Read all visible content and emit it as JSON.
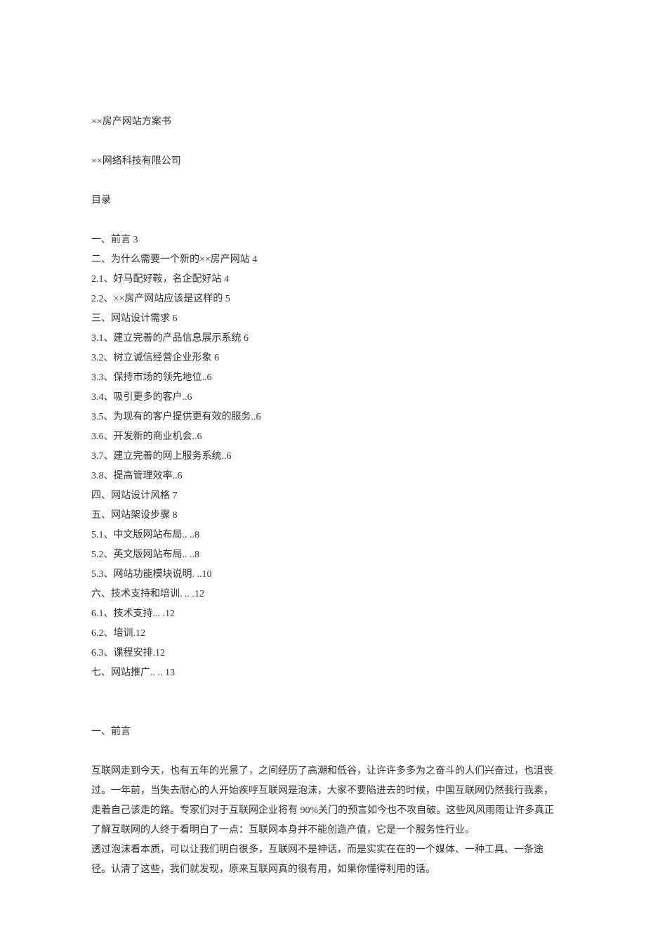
{
  "header": {
    "title": "××房产网站方案书",
    "company": "××网络科技有限公司"
  },
  "toc": {
    "heading": "目录",
    "items": [
      "一、前言 3",
      "二、为什么需要一个新的××房产网站 4",
      "2.1、好马配好鞍，名企配好站 4",
      "2.2、××房产网站应该是这样的 5",
      "三、网站设计需求 6",
      "3.1、建立完善的产品信息展示系统  6",
      "3.2、树立诚信经营企业形象 6",
      "3.3、保持市场的领先地位..6",
      "3.4、吸引更多的客户..6",
      "3.5、为现有的客户提供更有效的服务..6",
      "3.6、开发新的商业机会..6",
      "3.7、建立完善的网上服务系统..6",
      "3.8、提高管理效率..6",
      "四、网站设计风格 7",
      "五、网站架设步骤 8",
      "5.1、中文版网站布局.. ..8",
      "5.2、英文版网站布局.. ..8",
      "5.3、网站功能模块说明. ..10",
      "六、技术支持和培训. .. .12",
      "6.1、技术支持... .12",
      "6.2、培训.12",
      "6.3、课程安排.12",
      "七、网站推广.. .. 13"
    ]
  },
  "section1": {
    "heading": "一、前言",
    "paragraphs": [
      "互联网走到今天，也有五年的光景了，之间经历了高潮和低谷，让许许多多为之奋斗的人们兴奋过，也沮丧过。一年前，当失去耐心的人开始疾呼互联网是泡沫，大家不要陷进去的时候，中国互联网仍然我行我素，走着自己该走的路。专家们对于互联网企业将有 90%关门的预言如今也不攻自破。这些风风雨雨让许多真正了解互联网的人终于看明白了一点：互联网本身并不能创造产值，它是一个服务性行业。",
      "透过泡沫看本质，可以让我们明白很多，互联网不是神话，而是实实在在的一个媒体、一种工具、一条途径。认清了这些，我们就发现，原来互联网真的很有用，如果你懂得利用的话。"
    ]
  }
}
